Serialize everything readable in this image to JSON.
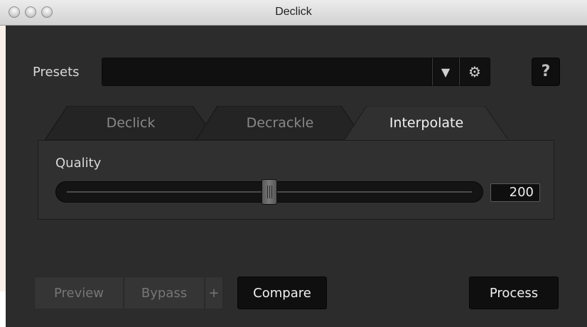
{
  "window": {
    "title": "Declick"
  },
  "presets": {
    "label": "Presets",
    "value": "",
    "dropdown_icon": "chevron-down-icon",
    "settings_icon": "gear-icon",
    "help_label": "?"
  },
  "tabs": [
    {
      "label": "Declick",
      "active": false
    },
    {
      "label": "Decrackle",
      "active": false
    },
    {
      "label": "Interpolate",
      "active": true
    }
  ],
  "quality": {
    "label": "Quality",
    "value": "200",
    "slider_fraction": 0.5
  },
  "bottom": {
    "preview_label": "Preview",
    "bypass_label": "Bypass",
    "plus_label": "+",
    "compare_label": "Compare",
    "process_label": "Process"
  },
  "colors": {
    "background": "#2b2b2b",
    "active_tab_text": "#f2f2f2",
    "inactive_tab_text": "#888888"
  }
}
